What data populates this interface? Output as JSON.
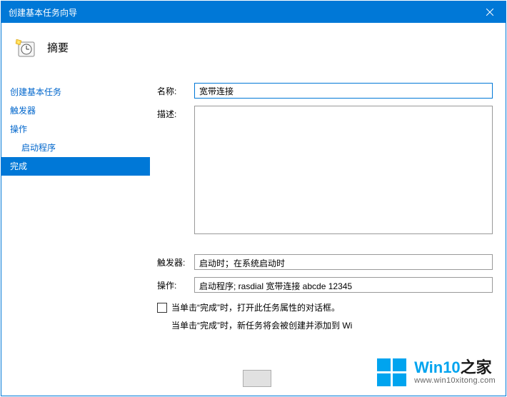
{
  "window": {
    "title": "创建基本任务向导"
  },
  "header": {
    "title": "摘要"
  },
  "sidebar": {
    "items": [
      {
        "label": "创建基本任务",
        "indent": false,
        "selected": false
      },
      {
        "label": "触发器",
        "indent": false,
        "selected": false
      },
      {
        "label": "操作",
        "indent": false,
        "selected": false
      },
      {
        "label": "启动程序",
        "indent": true,
        "selected": false
      },
      {
        "label": "完成",
        "indent": false,
        "selected": true
      }
    ]
  },
  "form": {
    "name_label": "名称:",
    "name_value": "宽带连接",
    "desc_label": "描述:",
    "desc_value": "",
    "trigger_label": "触发器:",
    "trigger_value": "启动时；在系统启动时",
    "action_label": "操作:",
    "action_value": "启动程序; rasdial 宽带连接 abcde 12345",
    "checkbox_label": "当单击“完成”时，打开此任务属性的对话框。",
    "info_text": "当单击“完成”时，新任务将会被创建并添加到 Wi"
  },
  "watermark": {
    "brand_prefix": "Win10",
    "brand_suffix": "之家",
    "url": "www.win10xitong.com"
  }
}
